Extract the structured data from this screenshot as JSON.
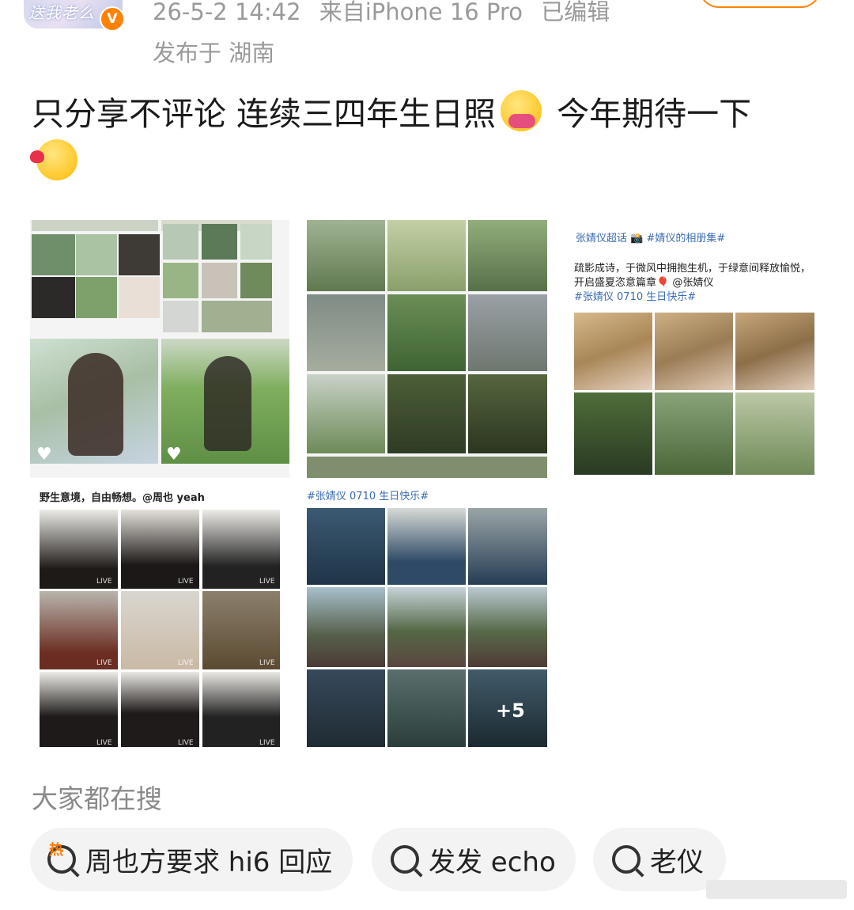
{
  "header": {
    "avatar_logo": "送我老么",
    "verified_badge": "V",
    "time": "26-5-2 14:42",
    "source": "来自iPhone 16 Pro",
    "edited": "已编辑",
    "location": "发布于 湖南"
  },
  "post": {
    "text_part1": "只分享不评论 连续三四年生日照",
    "text_part2": "今年期待一下",
    "emoji_1": "hugging-face-emoji",
    "emoji_2": "kissing-heart-emoji"
  },
  "images": {
    "collage3": {
      "cap1": "张婧仪超话 📸 #婧仪的相册集#",
      "cap2": "疏影成诗，于微风中拥抱生机，于绿意间释放愉悦，",
      "cap3": "开启盛夏恣意篇章🎈 @张婧仪",
      "cap4": "#张婧仪 0710 生日快乐#"
    },
    "collage4": {
      "cap": "野生意境，自由畅想。@周也 yeah",
      "live": "LIVE"
    },
    "collage5": {
      "cap": "#张婧仪 0710 生日快乐#",
      "more": "+5"
    }
  },
  "search": {
    "title": "大家都在搜",
    "hot_tag": "热",
    "chips": [
      "周也方要求 hi6 回应",
      "发发 echo",
      "老仪"
    ]
  }
}
